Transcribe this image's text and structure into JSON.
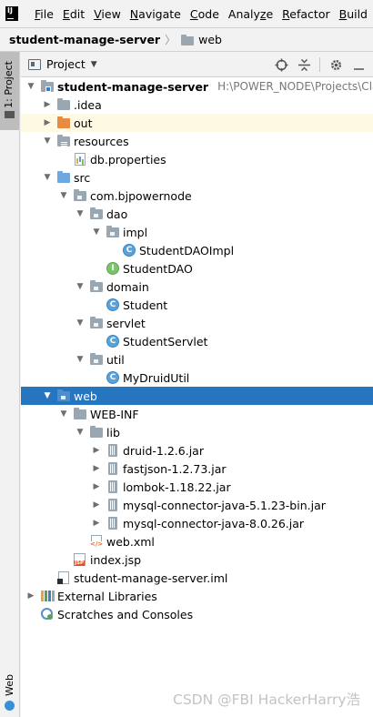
{
  "menubar": {
    "items": [
      {
        "mnemonic": "F",
        "rest": "ile"
      },
      {
        "mnemonic": "E",
        "rest": "dit"
      },
      {
        "mnemonic": "V",
        "rest": "iew"
      },
      {
        "mnemonic": "N",
        "rest": "avigate"
      },
      {
        "mnemonic": "C",
        "rest": "ode"
      },
      {
        "prefix": "Analy",
        "mnemonic": "z",
        "rest": "e"
      },
      {
        "mnemonic": "R",
        "rest": "efactor"
      },
      {
        "mnemonic": "B",
        "rest": "uild"
      }
    ]
  },
  "breadcrumb": {
    "project": "student-manage-server",
    "folder": "web"
  },
  "leftstrip": {
    "project_tab": "1: Project",
    "web_tab": "Web"
  },
  "panel": {
    "title": "Project"
  },
  "tree": [
    {
      "label": "student-manage-server",
      "path": "H:\\POWER_NODE\\Projects\\Classro",
      "icon": "module-folder",
      "expanded": true,
      "indent": 0
    },
    {
      "label": ".idea",
      "icon": "folder-gray",
      "expanded": false,
      "indent": 1
    },
    {
      "label": "out",
      "icon": "folder-orange",
      "expanded": false,
      "indent": 1
    },
    {
      "label": "resources",
      "icon": "folder-resources",
      "expanded": true,
      "indent": 1
    },
    {
      "label": "db.properties",
      "icon": "properties-file",
      "indent": 2
    },
    {
      "label": "src",
      "icon": "folder-source",
      "expanded": true,
      "indent": 1
    },
    {
      "label": "com.bjpowernode",
      "icon": "package",
      "expanded": true,
      "indent": 2
    },
    {
      "label": "dao",
      "icon": "package",
      "expanded": true,
      "indent": 3
    },
    {
      "label": "impl",
      "icon": "package",
      "expanded": true,
      "indent": 4
    },
    {
      "label": "StudentDAOImpl",
      "icon": "class",
      "indent": 5
    },
    {
      "label": "StudentDAO",
      "icon": "interface",
      "indent": 4
    },
    {
      "label": "domain",
      "icon": "package",
      "expanded": true,
      "indent": 3
    },
    {
      "label": "Student",
      "icon": "class",
      "indent": 4
    },
    {
      "label": "servlet",
      "icon": "package",
      "expanded": true,
      "indent": 3
    },
    {
      "label": "StudentServlet",
      "icon": "class",
      "indent": 4
    },
    {
      "label": "util",
      "icon": "package",
      "expanded": true,
      "indent": 3
    },
    {
      "label": "MyDruidUtil",
      "icon": "class",
      "indent": 4
    },
    {
      "label": "web",
      "icon": "folder-web",
      "expanded": true,
      "indent": 1,
      "selected": true
    },
    {
      "label": "WEB-INF",
      "icon": "folder-gray",
      "expanded": true,
      "indent": 2
    },
    {
      "label": "lib",
      "icon": "folder-gray",
      "expanded": true,
      "indent": 3
    },
    {
      "label": "druid-1.2.6.jar",
      "icon": "jar",
      "expanded": false,
      "indent": 4
    },
    {
      "label": "fastjson-1.2.73.jar",
      "icon": "jar",
      "expanded": false,
      "indent": 4
    },
    {
      "label": "lombok-1.18.22.jar",
      "icon": "jar",
      "expanded": false,
      "indent": 4
    },
    {
      "label": "mysql-connector-java-5.1.23-bin.jar",
      "icon": "jar",
      "expanded": false,
      "indent": 4
    },
    {
      "label": "mysql-connector-java-8.0.26.jar",
      "icon": "jar",
      "expanded": false,
      "indent": 4
    },
    {
      "label": "web.xml",
      "icon": "xml-file",
      "indent": 3
    },
    {
      "label": "index.jsp",
      "icon": "jsp-file",
      "indent": 2
    },
    {
      "label": "student-manage-server.iml",
      "icon": "iml-file",
      "indent": 1
    },
    {
      "label": "External Libraries",
      "icon": "libraries",
      "expanded": false,
      "indent": 0
    },
    {
      "label": "Scratches and Consoles",
      "icon": "scratches",
      "indent": 0
    }
  ],
  "watermark": "CSDN @FBI HackerHarry浩",
  "colors": {
    "selection": "#2675bf",
    "highlight_row": "#fdf9e3",
    "class_icon": "#59a2da",
    "interface_icon": "#7cc36e",
    "excluded_folder": "#e88c42"
  }
}
